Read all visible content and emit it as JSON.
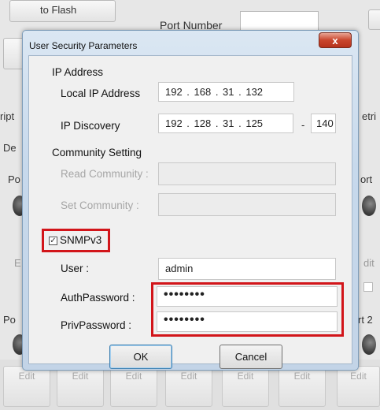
{
  "background": {
    "to_flash_label": "to Flash",
    "port_number_label": "Port Number",
    "left_fragments": [
      "ript",
      "De",
      "Po",
      "E",
      "Po"
    ],
    "right_fragments": [
      "etri",
      "ort",
      "dit",
      "rt 2"
    ],
    "edit_labels": [
      "Edit",
      "Edit",
      "Edit",
      "Edit",
      "Edit",
      "Edit",
      "Edit"
    ]
  },
  "dialog": {
    "title": "User Security Parameters",
    "close_glyph": "x",
    "ip_section": {
      "heading": "IP Address",
      "local_ip_label": "Local IP Address",
      "local_ip_value": "192 . 168 . 31 . 132",
      "discovery_label": "IP Discovery",
      "discovery_value": "192 . 128 . 31 . 125",
      "range_separator": "-",
      "discovery_end": "140"
    },
    "community": {
      "heading": "Community Setting",
      "read_label": "Read Community :",
      "read_value": "",
      "set_label": "Set Community :",
      "set_value": ""
    },
    "snmpv3": {
      "checkbox_label": "SNMPv3",
      "checked": true,
      "check_glyph": "✓",
      "user_label": "User :",
      "user_value": "admin",
      "auth_label": "AuthPassword :",
      "auth_value": "••••••••",
      "priv_label": "PrivPassword :",
      "priv_value": "••••••••"
    },
    "buttons": {
      "ok": "OK",
      "cancel": "Cancel"
    }
  },
  "colors": {
    "highlight": "#d2151a",
    "dialog_frame": "#c7d9ec",
    "close_button": "#c9452c"
  }
}
